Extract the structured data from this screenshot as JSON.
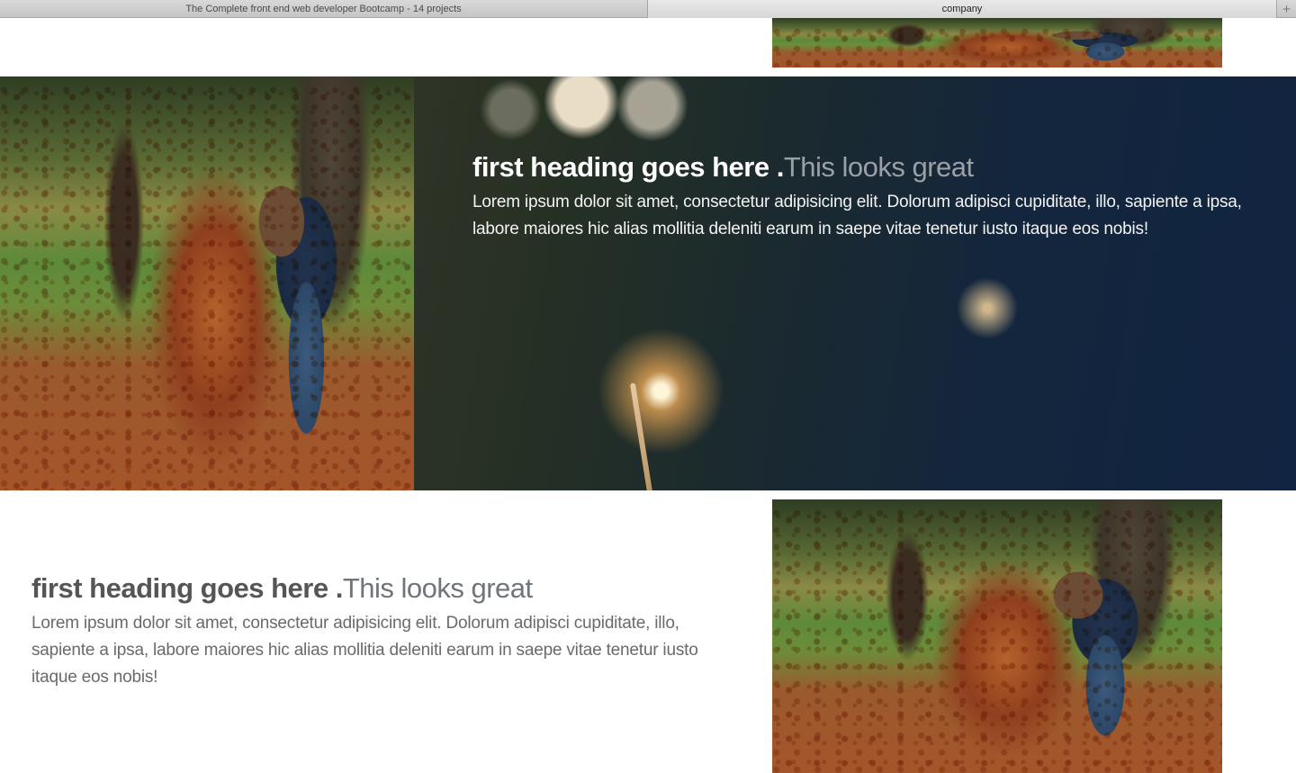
{
  "browser": {
    "tabs": [
      {
        "title": "The Complete front end web developer Bootcamp - 14 projects",
        "active": false
      },
      {
        "title": "company",
        "active": true
      }
    ],
    "new_tab_label": "+"
  },
  "feature_band": {
    "heading_main": "first heading goes here .",
    "heading_accent": "This looks great",
    "paragraph": "Lorem ipsum dolor sit amet, consectetur adipisicing elit. Dolorum adipisci cupiditate, illo, sapiente a ipsa, labore maiores hic alias mollitia deleniti earum in saepe vitae tenetur iusto itaque eos nobis!"
  },
  "content_section": {
    "heading_main": "first heading goes here .",
    "heading_accent": "This looks great",
    "paragraph": "Lorem ipsum dolor sit amet, consectetur adipisicing elit. Dolorum adipisci cupiditate, illo, sapiente a ipsa, labore maiores hic alias mollitia deleniti earum in saepe vitae tenetur iusto itaque eos nobis!"
  },
  "colors": {
    "feature_bg": "#112441",
    "heading_muted": "#9aa0a6",
    "body_text": "#6a6a6a"
  }
}
